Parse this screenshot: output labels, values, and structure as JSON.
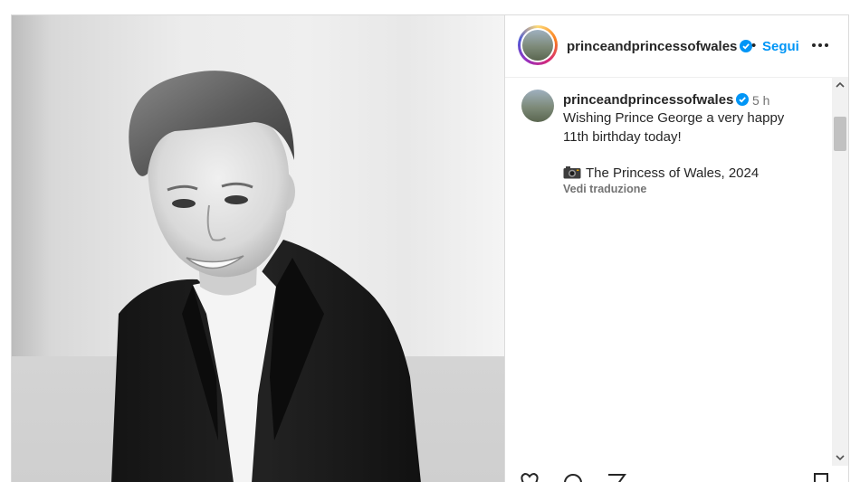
{
  "header": {
    "username": "princeandprincessofwales",
    "separator": "•",
    "follow_label": "Segui"
  },
  "caption": {
    "username": "princeandprincessofwales",
    "time": "5 h",
    "line1": "Wishing Prince George a very happy",
    "line2": "11th birthday today!",
    "credit": "The Princess of Wales, 2024",
    "translate_label": "Vedi traduzione"
  },
  "icons": {
    "verified": "verified-badge-icon",
    "more": "more-options-icon",
    "camera": "camera-icon",
    "scroll_up": "chevron-up-icon",
    "scroll_down": "chevron-down-icon"
  },
  "colors": {
    "accent": "#0095f6",
    "text": "#262626",
    "muted": "#737373",
    "border": "#dbdbdb"
  }
}
